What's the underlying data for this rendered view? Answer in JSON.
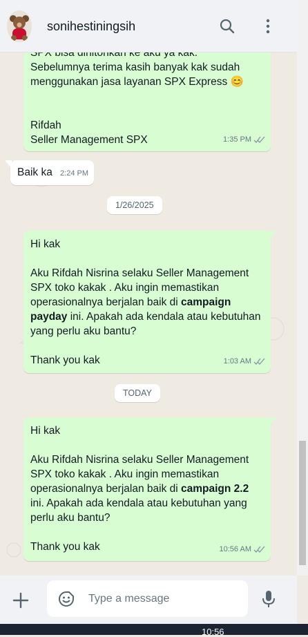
{
  "header": {
    "contact_name": "sonihestiningsih",
    "avatar_icon": "teddy-bear-avatar",
    "search_icon": "search-icon",
    "menu_icon": "more-vertical-icon"
  },
  "messages": [
    {
      "direction": "out",
      "lines": [
        "SPX bisa dihitonkan ke aku ya kak.",
        "Sebelumnya terima kasih banyak kak sudah",
        "menggunakan jasa layanan SPX Express 😊",
        "",
        "",
        "Rifdah",
        "Seller Management SPX"
      ],
      "time": "1:35 PM",
      "status": "read"
    },
    {
      "direction": "in",
      "text": "Baik ka",
      "time": "2:24 PM"
    },
    {
      "type": "date",
      "label": "1/26/2025"
    },
    {
      "direction": "out",
      "greeting": "Hi kak",
      "body_lines": [
        "Aku Rifdah Nisrina selaku Seller Management",
        "SPX toko kakak . Aku ingin memastikan",
        "operasionalnya berjalan baik di ",
        "campaign",
        "payday",
        " ini. Apakah ada kendala atau kebutuhan",
        "yang perlu aku bantu?"
      ],
      "closing": "Thank you kak",
      "time": "1:03 AM",
      "status": "read"
    },
    {
      "type": "date",
      "label": "TODAY"
    },
    {
      "direction": "out",
      "greeting": "Hi kak",
      "body_lines": [
        "Aku Rifdah Nisrina selaku Seller Management",
        "SPX toko kakak . Aku ingin memastikan",
        "operasionalnya berjalan baik di ",
        "campaign 2.2",
        "ini. Apakah ada kendala atau kebutuhan yang",
        "perlu aku bantu?"
      ],
      "closing": "Thank you kak",
      "time": "10:56 AM",
      "status": "read"
    }
  ],
  "composer": {
    "placeholder": "Type a message",
    "attach_icon": "plus-icon",
    "emoji_icon": "emoji-icon",
    "mic_icon": "microphone-icon"
  },
  "taskbar": {
    "clock": "10:56"
  },
  "colors": {
    "outgoing_bubble": "#d9fdd3",
    "incoming_bubble": "#ffffff",
    "chat_background": "#efeae2",
    "header_background": "#f0f2f5",
    "read_tick": "#8696a0"
  }
}
